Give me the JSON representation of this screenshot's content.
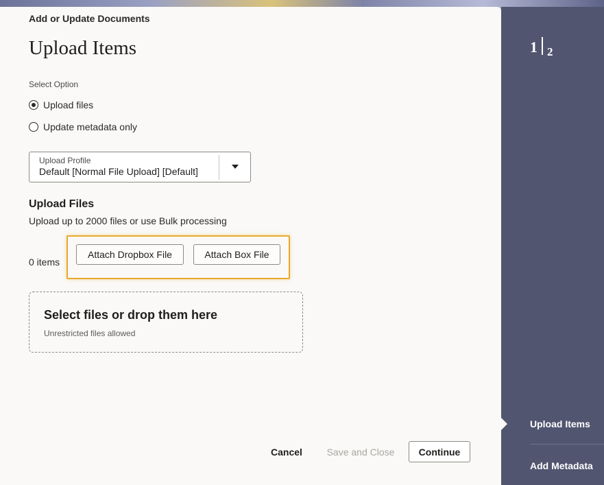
{
  "dialog": {
    "title": "Add or Update Documents",
    "heading": "Upload Items"
  },
  "options": {
    "label": "Select Option",
    "items": [
      {
        "label": "Upload files",
        "checked": true
      },
      {
        "label": "Update metadata only",
        "checked": false
      }
    ]
  },
  "upload_profile": {
    "label": "Upload Profile",
    "value": "Default [Normal File Upload] [Default]"
  },
  "upload_files": {
    "title": "Upload Files",
    "description": "Upload up to 2000 files or use Bulk processing",
    "count": "0 items",
    "attach_dropbox_label": "Attach Dropbox File",
    "attach_box_label": "Attach Box File",
    "highlight_color": "#e8a92c"
  },
  "drop_zone": {
    "title": "Select files or drop them here",
    "subtitle": "Unrestricted files allowed"
  },
  "footer": {
    "cancel_label": "Cancel",
    "save_close_label": "Save and Close",
    "continue_label": "Continue"
  },
  "steps": {
    "current": "1",
    "total": "2",
    "items": [
      "Upload Items",
      "Add Metadata"
    ],
    "panel_color": "#525570"
  }
}
